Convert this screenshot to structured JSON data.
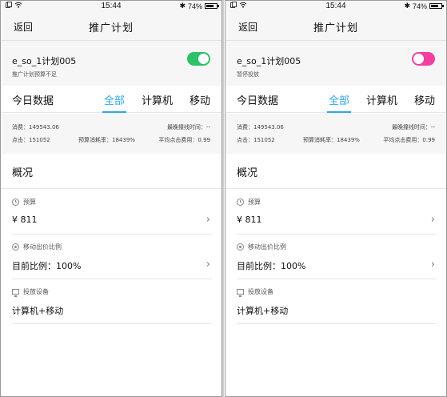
{
  "status_bar": {
    "time": "15:44",
    "battery": "74%",
    "battery_level": 0.74
  },
  "nav": {
    "back": "返回",
    "title": "推广计划"
  },
  "tabs": {
    "heading": "今日数据",
    "items": [
      "全部",
      "计算机",
      "移动"
    ],
    "active": "全部"
  },
  "stats": {
    "cost": "消费：149543.06",
    "clicks": "点击：151052",
    "latest_offline": "最晚撞线时间：--",
    "budget_rate": "预算消耗率：18439%",
    "avg_click_cost": "平均点击费用：0.99"
  },
  "overview": {
    "title": "概况",
    "budget_label": "预算",
    "budget_value": "¥ 811",
    "mobile_bid_label": "移动出价比例",
    "mobile_bid_value": "目前比例：100%",
    "device_label": "投放设备",
    "device_value": "计算机+移动"
  },
  "screens": [
    {
      "plan_name": "e_so_1计划005",
      "plan_status": "推广计划预算不足",
      "toggle": "on",
      "toggle_color": "#2ec06b"
    },
    {
      "plan_name": "e_so_1计划005",
      "plan_status": "暂停投放",
      "toggle": "off",
      "toggle_color": "#f23fa1"
    }
  ],
  "colors": {
    "accent": "#2fa6e8",
    "background": "#f6f6f6"
  }
}
